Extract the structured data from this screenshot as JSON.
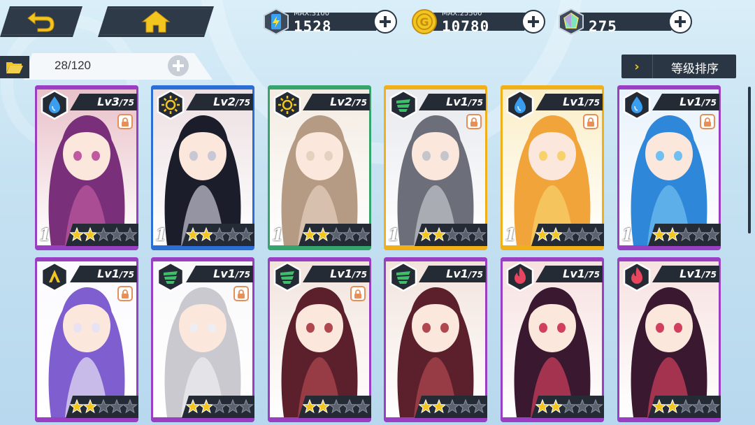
{
  "topbar": {
    "back_icon": "back-arrow-icon",
    "home_icon": "home-icon",
    "resources": [
      {
        "name": "energy",
        "icon": "energy-battery-icon",
        "max": "MAX:3100",
        "value": "1528"
      },
      {
        "name": "gold",
        "icon": "gold-coin-icon",
        "max": "MAX:25500",
        "value": "10780"
      },
      {
        "name": "gem",
        "icon": "crystal-gem-icon",
        "max": "",
        "value": "275"
      }
    ]
  },
  "subbar": {
    "count": "28/120",
    "sort_label": "等级排序"
  },
  "colors": {
    "purple": "#9a3fc4",
    "blue": "#2b6fd6",
    "green": "#35a56d",
    "yellow": "#f0b019",
    "dark": "#242b35",
    "accent": "#f0c419"
  },
  "cards": [
    {
      "level": "Lv3",
      "max": "/75",
      "element": "water",
      "rarity": "purple",
      "count": "1",
      "stars": 2,
      "locked": true,
      "palette": [
        "#7a2f7a",
        "#c05aa0",
        "#e8c0c8"
      ]
    },
    {
      "level": "Lv2",
      "max": "/75",
      "element": "light",
      "rarity": "blue",
      "count": "1",
      "stars": 2,
      "locked": false,
      "palette": [
        "#1b1d2a",
        "#c9c7d6",
        "#ecdfe2"
      ]
    },
    {
      "level": "Lv2",
      "max": "/75",
      "element": "light",
      "rarity": "green",
      "count": "1",
      "stars": 2,
      "locked": false,
      "palette": [
        "#b59a84",
        "#e6d1c0",
        "#f3ebe2"
      ]
    },
    {
      "level": "Lv1",
      "max": "/75",
      "element": "wind",
      "rarity": "yellow",
      "count": "1",
      "stars": 2,
      "locked": true,
      "palette": [
        "#6c6f79",
        "#c5c6cc",
        "#e8e9ee"
      ]
    },
    {
      "level": "Lv1",
      "max": "/75",
      "element": "water",
      "rarity": "yellow",
      "count": "1",
      "stars": 2,
      "locked": true,
      "palette": [
        "#f0a43a",
        "#f7d26b",
        "#fbeec6"
      ]
    },
    {
      "level": "Lv1",
      "max": "/75",
      "element": "water",
      "rarity": "purple",
      "count": "1",
      "stars": 2,
      "locked": true,
      "palette": [
        "#2f87d9",
        "#6fc0f0",
        "#e8f2fb"
      ]
    },
    {
      "level": "Lv1",
      "max": "/75",
      "element": "earth",
      "rarity": "purple",
      "count": "",
      "stars": 2,
      "locked": true,
      "palette": [
        "#7f5fd0",
        "#e7e2f4",
        "#fbfaff"
      ]
    },
    {
      "level": "Lv1",
      "max": "/75",
      "element": "wind",
      "rarity": "purple",
      "count": "",
      "stars": 2,
      "locked": true,
      "palette": [
        "#c9c9cf",
        "#eeeef2",
        "#f9f9fb"
      ]
    },
    {
      "level": "Lv1",
      "max": "/75",
      "element": "wind",
      "rarity": "purple",
      "count": "",
      "stars": 2,
      "locked": true,
      "palette": [
        "#5c1f2c",
        "#b0474f",
        "#f2e3dc"
      ]
    },
    {
      "level": "Lv1",
      "max": "/75",
      "element": "wind",
      "rarity": "purple",
      "count": "",
      "stars": 2,
      "locked": false,
      "palette": [
        "#5c1f2c",
        "#b0474f",
        "#f2e3dc"
      ]
    },
    {
      "level": "Lv1",
      "max": "/75",
      "element": "fire",
      "rarity": "purple",
      "count": "",
      "stars": 2,
      "locked": false,
      "palette": [
        "#3a1830",
        "#d23f5e",
        "#f6e1e0"
      ]
    },
    {
      "level": "Lv1",
      "max": "/75",
      "element": "fire",
      "rarity": "purple",
      "count": "",
      "stars": 2,
      "locked": false,
      "palette": [
        "#3a1830",
        "#d23f5e",
        "#f6e1e0"
      ]
    }
  ]
}
